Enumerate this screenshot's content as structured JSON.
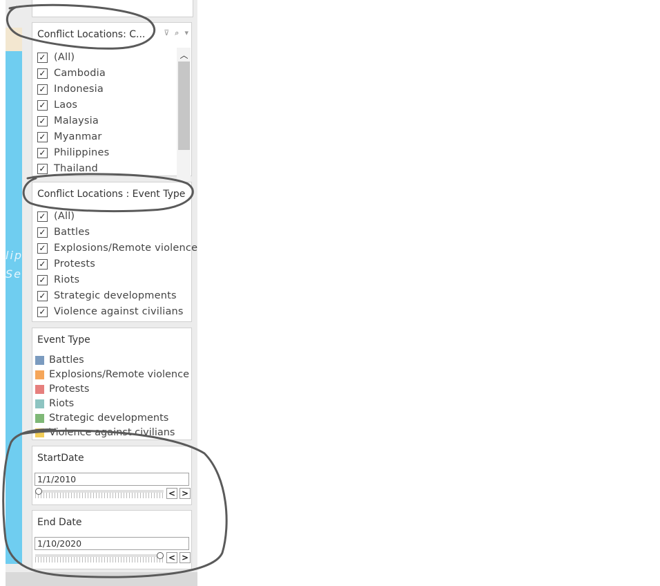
{
  "colors": {
    "panel_bg": "#ececec",
    "map_blue": "#6fcdf0",
    "accent_tan": "#f3e7d0",
    "annotation_stroke": "#5a5a5a"
  },
  "map_ghost_text": [
    "lip",
    "Se"
  ],
  "location_filter": {
    "title": "Conflict Locations: C...",
    "icons": [
      "filter-icon",
      "search-icon",
      "dropdown-icon"
    ],
    "items": [
      {
        "label": "(All)",
        "checked": true
      },
      {
        "label": "Cambodia",
        "checked": true
      },
      {
        "label": "Indonesia",
        "checked": true
      },
      {
        "label": "Laos",
        "checked": true
      },
      {
        "label": "Malaysia",
        "checked": true
      },
      {
        "label": "Myanmar",
        "checked": true
      },
      {
        "label": "Philippines",
        "checked": true
      },
      {
        "label": "Thailand",
        "checked": true
      }
    ]
  },
  "event_filter": {
    "title": "Conflict Locations : Event Type",
    "items": [
      {
        "label": "(All)",
        "checked": true
      },
      {
        "label": "Battles",
        "checked": true
      },
      {
        "label": "Explosions/Remote violence",
        "checked": true
      },
      {
        "label": "Protests",
        "checked": true
      },
      {
        "label": "Riots",
        "checked": true
      },
      {
        "label": "Strategic developments",
        "checked": true
      },
      {
        "label": "Violence against civilians",
        "checked": true
      }
    ]
  },
  "legend": {
    "title": "Event Type",
    "items": [
      {
        "label": "Battles",
        "color": "#7b9bbf"
      },
      {
        "label": "Explosions/Remote violence",
        "color": "#f5a65a"
      },
      {
        "label": "Protests",
        "color": "#e67f7d"
      },
      {
        "label": "Riots",
        "color": "#8dc4c1"
      },
      {
        "label": "Strategic developments",
        "color": "#7fb877"
      },
      {
        "label": "Violence against civilians",
        "color": "#f2cd58"
      }
    ]
  },
  "start_date": {
    "title": "StartDate",
    "value": "1/1/2010",
    "slider_position": 0.0,
    "prev": "<",
    "next": ">"
  },
  "end_date": {
    "title": "End Date",
    "value": "1/10/2020",
    "slider_position": 1.0,
    "prev": "<",
    "next": ">"
  },
  "check_glyph": "✓"
}
